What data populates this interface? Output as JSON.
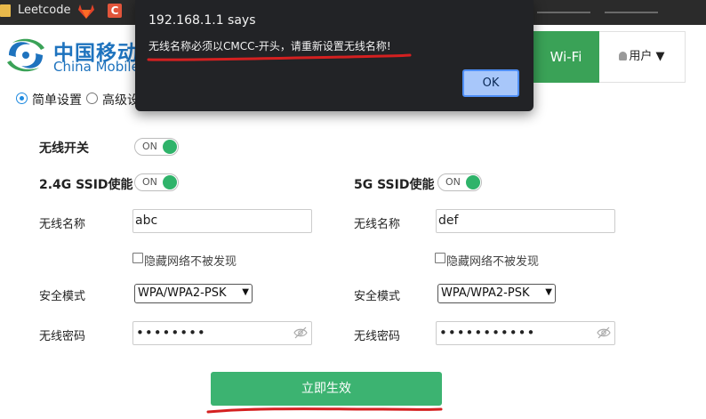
{
  "bookmarks": {
    "items": [
      {
        "label": "Leetcode",
        "icon": "folder-icon"
      },
      {
        "label": "",
        "icon": "gitlab-icon"
      },
      {
        "label": "C",
        "icon": "c-icon"
      }
    ]
  },
  "header": {
    "logo_cn": "中国移动",
    "logo_en": "China Mobile",
    "nav": [
      {
        "label": "Wi-Fi",
        "active": true
      },
      {
        "label": "用户 ▼",
        "active": false
      }
    ]
  },
  "tabs": [
    {
      "label": "简单设置",
      "selected": true
    },
    {
      "label": "高级设",
      "selected": false
    }
  ],
  "form": {
    "wireless_switch": {
      "label": "无线开关",
      "toggle": "ON"
    },
    "band_24": {
      "label": "2.4G SSID使能",
      "toggle": "ON",
      "ssid_label": "无线名称",
      "ssid_value": "abc",
      "hide_label": "隐藏网络不被发现",
      "security_label": "安全模式",
      "security_value": "WPA/WPA2-PSK",
      "password_label": "无线密码",
      "password_value": "••••••••"
    },
    "band_5": {
      "label": "5G SSID使能",
      "toggle": "ON",
      "ssid_label": "无线名称",
      "ssid_value": "def",
      "hide_label": "隐藏网络不被发现",
      "security_label": "安全模式",
      "security_value": "WPA/WPA2-PSK",
      "password_label": "无线密码",
      "password_value": "•••••••••••"
    },
    "submit_label": "立即生效"
  },
  "dialog": {
    "title": "192.168.1.1 says",
    "message": "无线名称必须以CMCC-开头，请重新设置无线名称!",
    "ok_label": "OK"
  },
  "colors": {
    "brand_blue": "#1e73be",
    "nav_green": "#3aa257",
    "toggle_green": "#2fb36a",
    "submit_green": "#3cb371",
    "annotation_red": "#d42020",
    "dialog_bg": "#222326",
    "ok_button": "#a8c7fa"
  }
}
